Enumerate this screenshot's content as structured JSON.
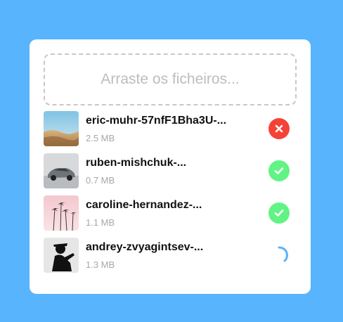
{
  "dropzone": {
    "placeholder": "Arraste os ficheiros..."
  },
  "files": [
    {
      "name": "eric-muhr-57nfF1Bha3U-...",
      "size": "2.5 MB",
      "status": "error",
      "thumb": "desert-landscape"
    },
    {
      "name": "ruben-mishchuk-...",
      "size": "0.7 MB",
      "status": "done",
      "thumb": "silver-car"
    },
    {
      "name": "caroline-hernandez-...",
      "size": "1.1 MB",
      "status": "done",
      "thumb": "palm-trees"
    },
    {
      "name": "andrey-zvyagintsev-...",
      "size": "1.3 MB",
      "status": "uploading",
      "thumb": "person-silhouette"
    }
  ],
  "colors": {
    "background": "#58b4fc",
    "error": "#f44336",
    "success": "#61f484",
    "spinner": "#58b4fc"
  }
}
